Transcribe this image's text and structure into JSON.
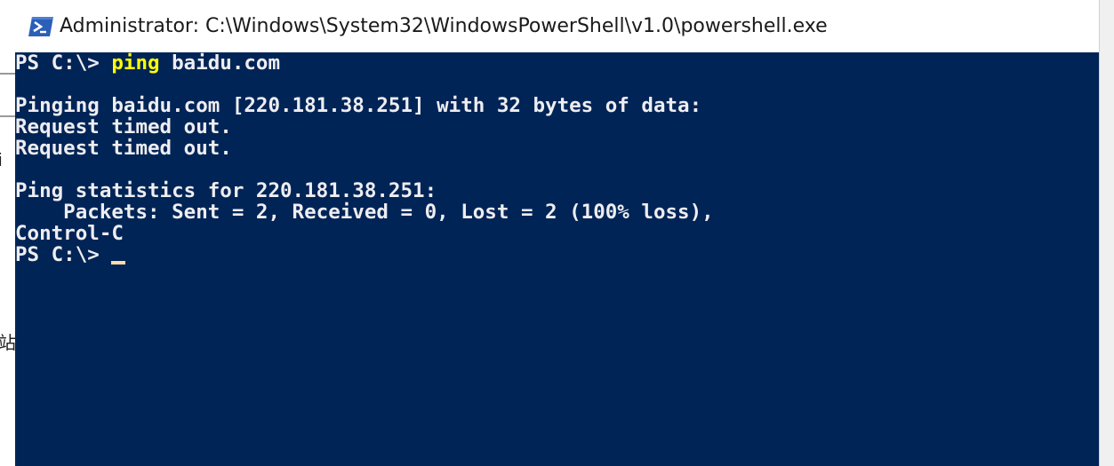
{
  "background": {
    "fragment1": "i",
    "fragment2": "站"
  },
  "window": {
    "title": "Administrator: C:\\Windows\\System32\\WindowsPowerShell\\v1.0\\powershell.exe",
    "icon": "powershell-icon"
  },
  "console": {
    "prompt1": "PS C:\\> ",
    "command1": "ping",
    "args1": " baidu.com",
    "line2": "Pinging baidu.com [220.181.38.251] with 32 bytes of data:",
    "line3": "Request timed out.",
    "line4": "Request timed out.",
    "line5": "Ping statistics for 220.181.38.251:",
    "line6": "    Packets: Sent = 2, Received = 0, Lost = 2 (100% loss),",
    "line7": "Control-C",
    "prompt2": "PS C:\\> "
  },
  "colors": {
    "console_bg": "#012456",
    "console_text": "#eeedf0",
    "command_text": "#ffff00",
    "cursor": "#fedba9"
  }
}
